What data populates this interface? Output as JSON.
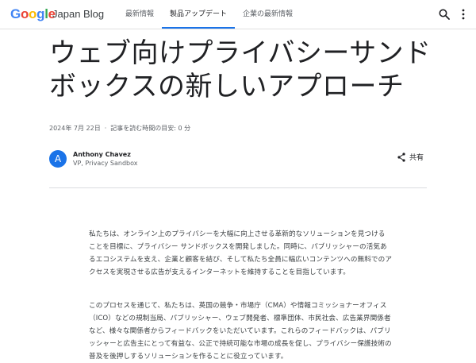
{
  "header": {
    "logo": {
      "text": "Google",
      "letters": [
        "G",
        "o",
        "o",
        "g",
        "l",
        "e"
      ],
      "colors": [
        "#4285F4",
        "#EA4335",
        "#FBBC05",
        "#4285F4",
        "#34A853",
        "#EA4335"
      ]
    },
    "blog_name": "Japan Blog",
    "nav": [
      {
        "label": "最新情報",
        "active": false
      },
      {
        "label": "製品アップデート",
        "active": true
      },
      {
        "label": "企業の最新情報",
        "active": false
      }
    ],
    "icons": [
      "search-icon",
      "more-vert-icon"
    ]
  },
  "article": {
    "title": "ウェブ向けプライバシーサンドボックスの新しいアプローチ",
    "date": "2024年 7月 22日",
    "separator": "·",
    "reading_time": "記事を読む時間の目安: 0 分",
    "author": {
      "initial": "A",
      "name": "Anthony Chavez",
      "title": "VP, Privacy Sandbox"
    },
    "share_label": "共有",
    "paragraphs": [
      "私たちは、オンライン上のプライバシーを大幅に向上させる革新的なソリューションを見つけることを目標に、プライバシー サンドボックスを開発しました。同時に、パブリッシャーの活気あるエコシステムを支え、企業と顧客を結び、そして私たち全員に幅広いコンテンツへの無料でのアクセスを実現させる広告が支えるインターネットを維持することを目指しています。",
      "このプロセスを通じて、私たちは、英国の競争・市場庁（CMA）や情報コミッショナーオフィス（ICO）などの規制当局、パブリッシャー、ウェブ開発者、標準団体、市民社会、広告業界関係者など、様々な関係者からフィードバックをいただいています。これらのフィードバックは、パブリッシャーと広告主にとって有益な、公正で持続可能な市場の成長を促し、プライバシー保護技術の普及を後押しするソリューションを作ることに役立っています。"
    ]
  },
  "colors": {
    "accent": "#1a73e8",
    "text": "#202124",
    "muted": "#5f6368"
  }
}
